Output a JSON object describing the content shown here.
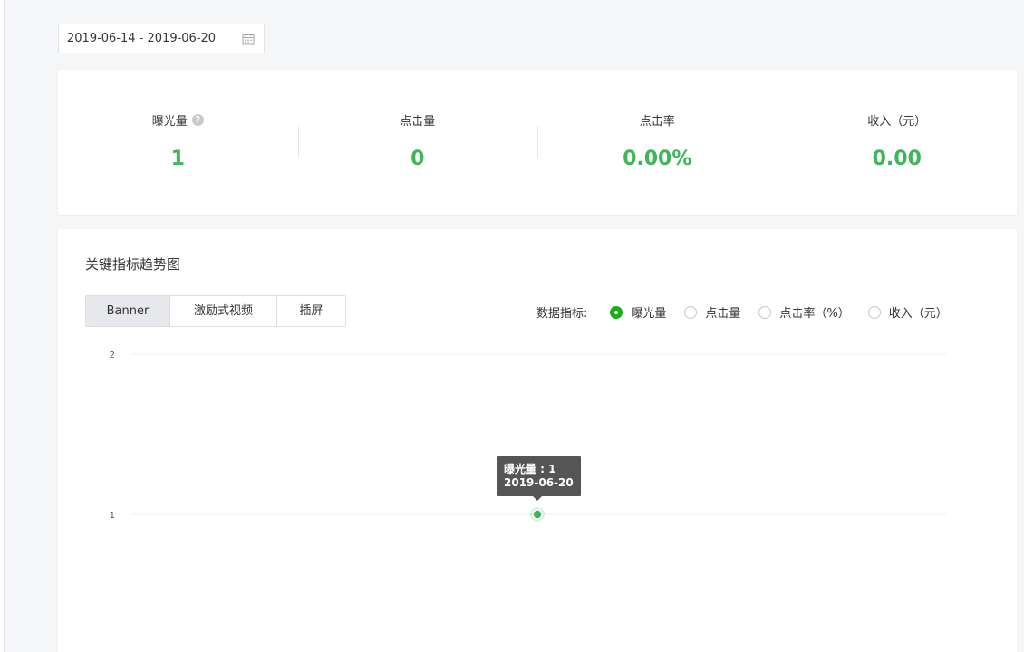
{
  "date_range": {
    "value": "2019-06-14 - 2019-06-20",
    "icon": "calendar-icon"
  },
  "stats": [
    {
      "label": "曝光量",
      "value": "1",
      "has_help": true
    },
    {
      "label": "点击量",
      "value": "0",
      "has_help": false
    },
    {
      "label": "点击率",
      "value": "0.00%",
      "has_help": false
    },
    {
      "label": "收入（元）",
      "value": "0.00",
      "has_help": false
    }
  ],
  "colors": {
    "accent_green": "#3eb65a",
    "radio_green": "#1aad19",
    "tooltip_bg": "#555555"
  },
  "trend": {
    "title": "关键指标趋势图",
    "tabs": [
      {
        "label": "Banner",
        "active": true
      },
      {
        "label": "激励式视频",
        "active": false
      },
      {
        "label": "插屏",
        "active": false
      }
    ],
    "metric_label": "数据指标:",
    "metrics": [
      {
        "label": "曝光量",
        "checked": true
      },
      {
        "label": "点击量",
        "checked": false
      },
      {
        "label": "点击率（%）",
        "checked": false
      },
      {
        "label": "收入（元）",
        "checked": false
      }
    ]
  },
  "chart_data": {
    "type": "line",
    "series": [
      {
        "values": [
          {
            "x": "2019-06-20",
            "y": 1
          }
        ]
      }
    ],
    "ylim": [
      0,
      2
    ],
    "yticks": [
      2,
      1
    ],
    "grid": true,
    "tooltip": {
      "line1": "曝光量 : 1",
      "line2": "2019-06-20"
    }
  }
}
